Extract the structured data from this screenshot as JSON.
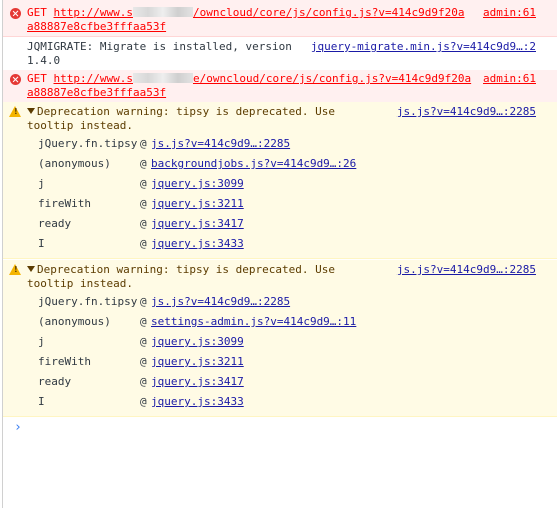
{
  "messages": [
    {
      "type": "error",
      "method": "GET",
      "url_prefix": "http://www.s",
      "url_suffix": "/owncloud/core/js/config.js?v=414c9d9f20a",
      "url_line2": "a88887e8cfbe3fffaa53f",
      "source": "admin:61"
    },
    {
      "type": "log",
      "text_line1": "JQMIGRATE: Migrate is installed, version",
      "text_line2": "1.4.0",
      "source": "jquery-migrate.min.js?v=414c9d9…:2"
    },
    {
      "type": "error",
      "method": "GET",
      "url_prefix": "http://www.s",
      "url_suffix": "e/owncloud/core/js/config.js?v=414c9d9f20a",
      "url_line2": "a88887e8cfbe3fffaa53f",
      "source": "admin:61"
    },
    {
      "type": "warning",
      "text_line1": "Deprecation warning: tipsy is deprecated. Use",
      "text_line2": "tooltip instead.",
      "source": "js.js?v=414c9d9…:2285",
      "stack": [
        {
          "fn": "jQuery.fn.tipsy",
          "at": "@",
          "link": "js.js?v=414c9d9…:2285"
        },
        {
          "fn": "(anonymous)",
          "at": "@",
          "link": "backgroundjobs.js?v=414c9d9…:26"
        },
        {
          "fn": "j",
          "at": "@",
          "link": "jquery.js:3099"
        },
        {
          "fn": "fireWith",
          "at": "@",
          "link": "jquery.js:3211"
        },
        {
          "fn": "ready",
          "at": "@",
          "link": "jquery.js:3417"
        },
        {
          "fn": "I",
          "at": "@",
          "link": "jquery.js:3433"
        }
      ]
    },
    {
      "type": "warning",
      "text_line1": "Deprecation warning: tipsy is deprecated. Use",
      "text_line2": "tooltip instead.",
      "source": "js.js?v=414c9d9…:2285",
      "stack": [
        {
          "fn": "jQuery.fn.tipsy",
          "at": "@",
          "link": "js.js?v=414c9d9…:2285"
        },
        {
          "fn": "(anonymous)",
          "at": "@",
          "link": "settings-admin.js?v=414c9d9…:11"
        },
        {
          "fn": "j",
          "at": "@",
          "link": "jquery.js:3099"
        },
        {
          "fn": "fireWith",
          "at": "@",
          "link": "jquery.js:3211"
        },
        {
          "fn": "ready",
          "at": "@",
          "link": "jquery.js:3417"
        },
        {
          "fn": "I",
          "at": "@",
          "link": "jquery.js:3433"
        }
      ]
    }
  ],
  "prompt_symbol": "›",
  "icons": {
    "error": "error-circle-icon",
    "warning": "warning-triangle-icon",
    "prompt": "prompt-chevron-icon"
  },
  "colors": {
    "error_bg": "#fff0f0",
    "warning_bg": "#fffbe5",
    "error_text": "#ff0000",
    "link": "#1a1aa6",
    "prompt": "#367cf1"
  }
}
